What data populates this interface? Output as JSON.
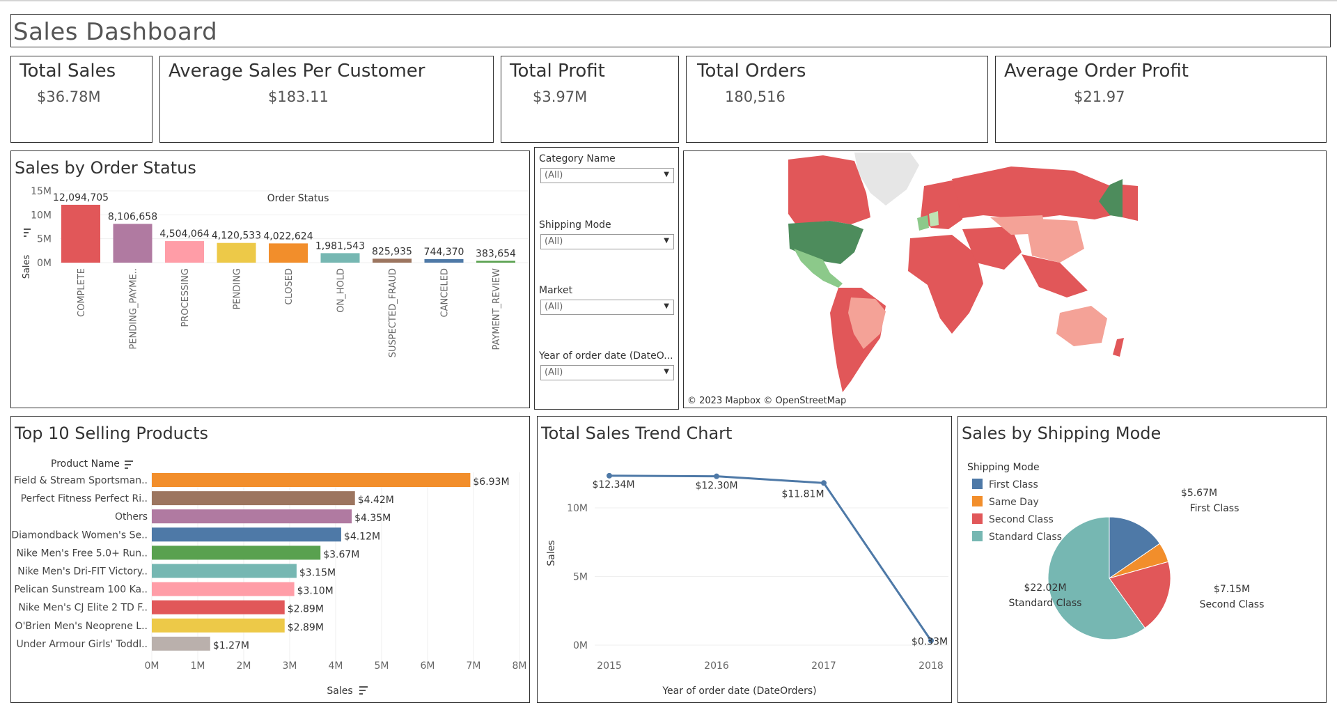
{
  "dashboard": {
    "title": "Sales Dashboard"
  },
  "kpis": [
    {
      "title": "Total Sales",
      "value": "$36.78M"
    },
    {
      "title": "Average Sales Per Customer",
      "value": "$183.11"
    },
    {
      "title": "Total Profit",
      "value": "$3.97M"
    },
    {
      "title": "Total Orders",
      "value": "180,516"
    },
    {
      "title": "Average Order Profit",
      "value": "$21.97"
    }
  ],
  "filters": [
    {
      "label": "Category Name",
      "value": "(All)"
    },
    {
      "label": "Shipping Mode",
      "value": "(All)"
    },
    {
      "label": "Market",
      "value": "(All)"
    },
    {
      "label": "Year of order date (DateO...",
      "value": "(All)"
    }
  ],
  "map": {
    "attribution": "© 2023 Mapbox  © OpenStreetMap"
  },
  "colors": {
    "accent": "#4e79a7"
  },
  "chart_data": [
    {
      "type": "bar",
      "title": "Sales by Order Status",
      "header": "Order Status",
      "ylabel": "Sales",
      "ylim": [
        0,
        15000000
      ],
      "y_ticks": [
        "0M",
        "5M",
        "10M",
        "15M"
      ],
      "y_tick_values": [
        0,
        5000000,
        10000000,
        15000000
      ],
      "categories": [
        "COMPLETE",
        "PENDING_PAYME..",
        "PROCESSING",
        "PENDING",
        "CLOSED",
        "ON_HOLD",
        "SUSPECTED_FRAUD",
        "CANCELED",
        "PAYMENT_REVIEW"
      ],
      "values": [
        12094705,
        8106658,
        4504064,
        4120533,
        4022624,
        1981543,
        825935,
        744370,
        383654
      ],
      "labels": [
        "12,094,705",
        "8,106,658",
        "4,504,064",
        "4,120,533",
        "4,022,624",
        "1,981,543",
        "825,935",
        "744,370",
        "383,654"
      ],
      "colors": [
        "#e15759",
        "#b07aa1",
        "#ff9da7",
        "#edc948",
        "#f28e2b",
        "#76b7b2",
        "#9c755f",
        "#4e79a7",
        "#59a14f"
      ]
    },
    {
      "type": "bar",
      "orientation": "horizontal",
      "title": "Top 10 Selling Products",
      "category_header": "Product Name",
      "xlabel": "Sales",
      "xlim": [
        0,
        8000000
      ],
      "x_ticks": [
        "0M",
        "1M",
        "2M",
        "3M",
        "4M",
        "5M",
        "6M",
        "7M",
        "8M"
      ],
      "categories": [
        "Field & Stream Sportsman..",
        "Perfect Fitness Perfect Ri..",
        "Others",
        "Diamondback Women's Se..",
        "Nike Men's Free 5.0+ Run..",
        "Nike Men's Dri-FIT Victory..",
        "Pelican Sunstream 100 Ka..",
        "Nike Men's CJ Elite 2 TD F..",
        "O'Brien Men's Neoprene L..",
        "Under Armour Girls' Toddl.."
      ],
      "values": [
        6930000,
        4420000,
        4350000,
        4120000,
        3670000,
        3150000,
        3100000,
        2890000,
        2890000,
        1270000
      ],
      "labels": [
        "$6.93M",
        "$4.42M",
        "$4.35M",
        "$4.12M",
        "$3.67M",
        "$3.15M",
        "$3.10M",
        "$2.89M",
        "$2.89M",
        "$1.27M"
      ],
      "colors": [
        "#f28e2b",
        "#9c755f",
        "#b07aa1",
        "#4e79a7",
        "#59a14f",
        "#76b7b2",
        "#ff9da7",
        "#e15759",
        "#edc948",
        "#bab0ac"
      ]
    },
    {
      "type": "line",
      "title": "Total Sales Trend Chart",
      "xlabel": "Year of order date (DateOrders)",
      "ylabel": "Sales",
      "x": [
        "2015",
        "2016",
        "2017",
        "2018"
      ],
      "values": [
        12340000,
        12300000,
        11810000,
        330000
      ],
      "labels": [
        "$12.34M",
        "$12.30M",
        "$11.81M",
        "$0.33M"
      ],
      "ylim": [
        0,
        13500000
      ],
      "y_ticks": [
        "0M",
        "5M",
        "10M"
      ],
      "y_tick_values": [
        0,
        5000000,
        10000000
      ],
      "color": "#4e79a7"
    },
    {
      "type": "pie",
      "title": "Sales by Shipping Mode",
      "legend_title": "Shipping Mode",
      "legend_position": "top-left",
      "categories": [
        "First Class",
        "Same Day",
        "Second Class",
        "Standard Class"
      ],
      "values": [
        5670000,
        1920000,
        7150000,
        22020000
      ],
      "labels": [
        "$5.67M",
        "",
        "$7.15M",
        "$22.02M"
      ],
      "colors": [
        "#4e79a7",
        "#f28e2b",
        "#e15759",
        "#76b7b2"
      ]
    }
  ]
}
